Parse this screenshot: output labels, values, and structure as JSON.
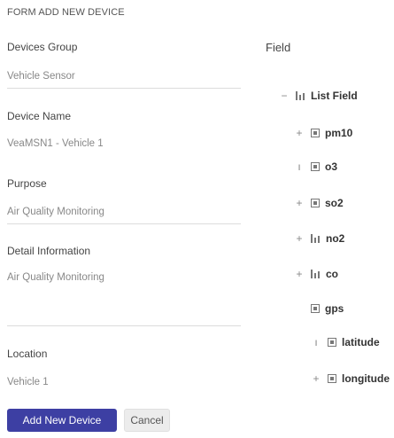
{
  "form": {
    "title": "FORM ADD NEW DEVICE",
    "devices_group_label": "Devices Group",
    "devices_group_value": "Vehicle Sensor",
    "device_name_label": "Device Name",
    "device_name_value": "VeaMSN1 - Vehicle 1",
    "purpose_label": "Purpose",
    "purpose_value": "Air Quality Monitoring",
    "detail_label": "Detail Information",
    "detail_value": "Air Quality Monitoring",
    "location_label": "Location",
    "location_value": "Vehicle 1"
  },
  "field_panel": {
    "heading": "Field",
    "root": {
      "expander": "−",
      "label": "List Field",
      "icon": "bar-list-icon"
    },
    "items": [
      {
        "expander": "+",
        "label": "pm10",
        "icon": "box-icon"
      },
      {
        "expander": "ı",
        "label": "o3",
        "icon": "box-icon"
      },
      {
        "expander": "+",
        "label": "so2",
        "icon": "box-icon"
      },
      {
        "expander": "+",
        "label": "no2",
        "icon": "bar-list-icon"
      },
      {
        "expander": "+",
        "label": "co",
        "icon": "bar-list-icon"
      },
      {
        "expander": "",
        "label": "gps",
        "icon": "box-icon"
      },
      {
        "expander": "ı",
        "label": "latitude",
        "icon": "box-icon"
      },
      {
        "expander": "+",
        "label": "longitude",
        "icon": "box-icon"
      }
    ]
  },
  "buttons": {
    "add_label": "Add New Device",
    "cancel_label": "Cancel"
  },
  "colors": {
    "primary": "#3d3fa3"
  }
}
